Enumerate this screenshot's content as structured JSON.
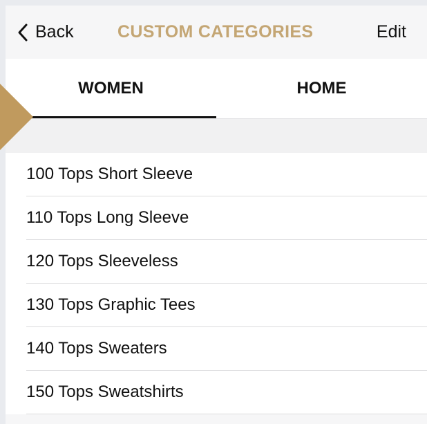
{
  "navbar": {
    "back_label": "Back",
    "title": "CUSTOM CATEGORIES",
    "edit_label": "Edit",
    "accent_color": "#c4a674"
  },
  "tabs": [
    {
      "label": "WOMEN",
      "active": true
    },
    {
      "label": "HOME",
      "active": false
    }
  ],
  "categories": [
    {
      "label": "100 Tops Short Sleeve"
    },
    {
      "label": "110 Tops Long Sleeve"
    },
    {
      "label": "120 Tops Sleeveless"
    },
    {
      "label": "130 Tops Graphic Tees"
    },
    {
      "label": "140 Tops Sweaters"
    },
    {
      "label": "150 Tops Sweatshirts"
    }
  ],
  "icons": {
    "back": "chevron-left-icon",
    "pointer": "triangle-pointer"
  },
  "colors": {
    "pointer": "#c09a5e",
    "background": "#e9ebef"
  }
}
